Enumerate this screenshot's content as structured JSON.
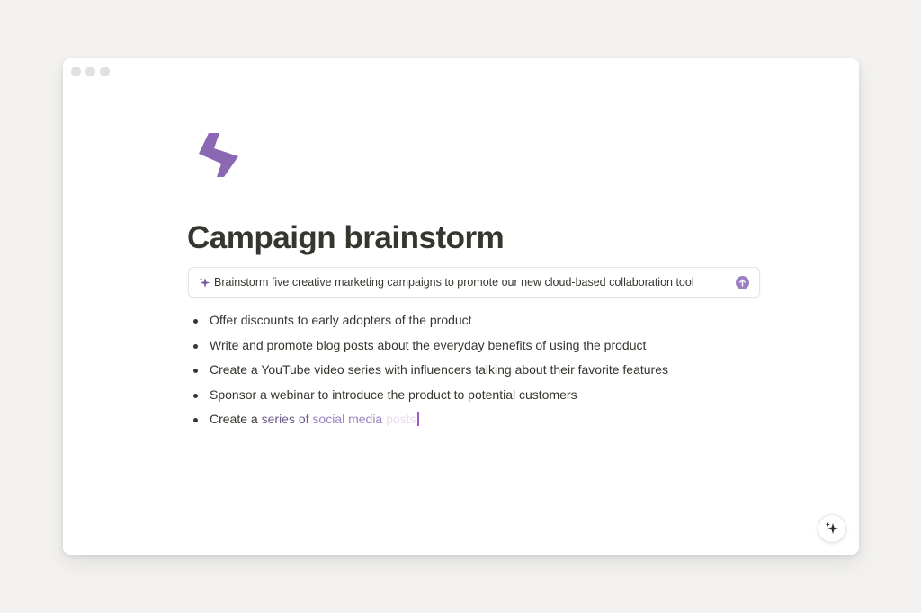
{
  "page": {
    "title": "Campaign brainstorm",
    "icon": "lightning-bolt-icon",
    "accent_color": "#8b68b3"
  },
  "ai_prompt": {
    "icon": "sparkle-icon",
    "text": "Brainstorm five creative marketing campaigns to promote our new cloud-based collaboration tool",
    "submit_icon": "arrow-up-icon"
  },
  "list": {
    "items": [
      "Offer discounts to early adopters of the product",
      "Write and promote blog posts about the everyday benefits of using the product",
      "Create a YouTube video series with influencers talking about their favorite features",
      "Sponsor a webinar to introduce the product to potential customers"
    ],
    "streaming_item": {
      "segments": [
        "Create a ",
        "series of ",
        "social media ",
        "posts"
      ]
    }
  },
  "ai_button": {
    "icon": "sparkles-icon"
  }
}
